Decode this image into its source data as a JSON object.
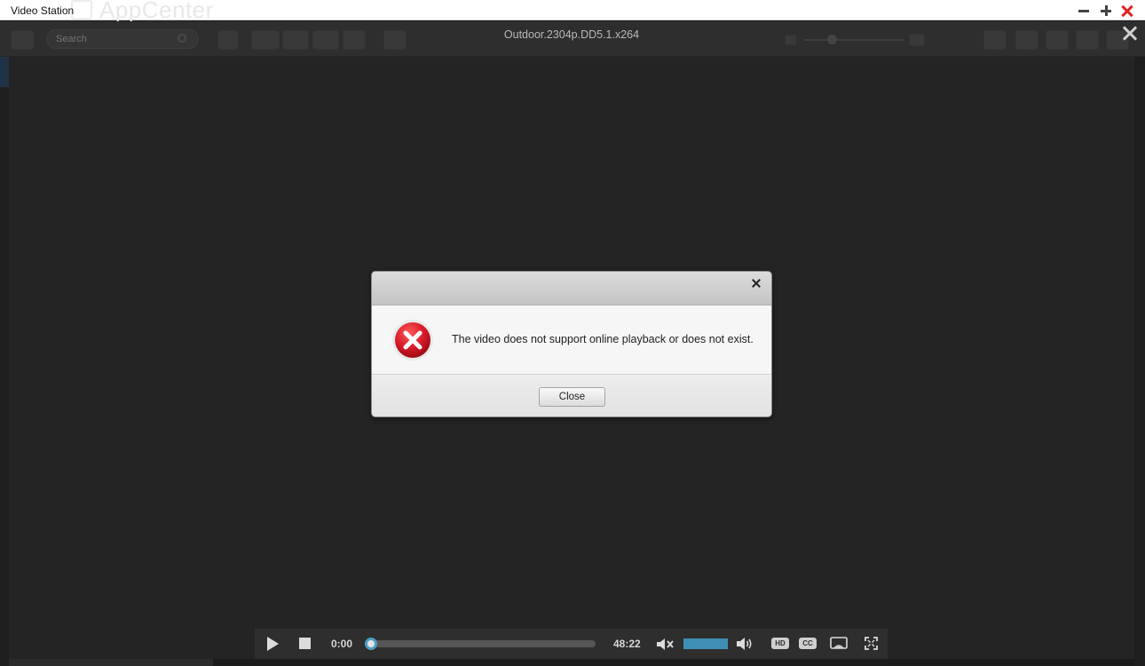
{
  "window": {
    "title": "Video Station",
    "background_app_name": "AppCenter"
  },
  "toolbar": {
    "search_placeholder": "Search",
    "video_title": "Outdoor.2304p.DD5.1.x264"
  },
  "dialog": {
    "message": "The video does not support online playback or does not exist.",
    "close_label": "Close"
  },
  "player": {
    "current_time": "0:00",
    "total_time": "48:22",
    "hd_label": "HD",
    "cc_label": "CC"
  },
  "colors": {
    "accent": "#3f8fb5",
    "error": "#d71a28"
  }
}
